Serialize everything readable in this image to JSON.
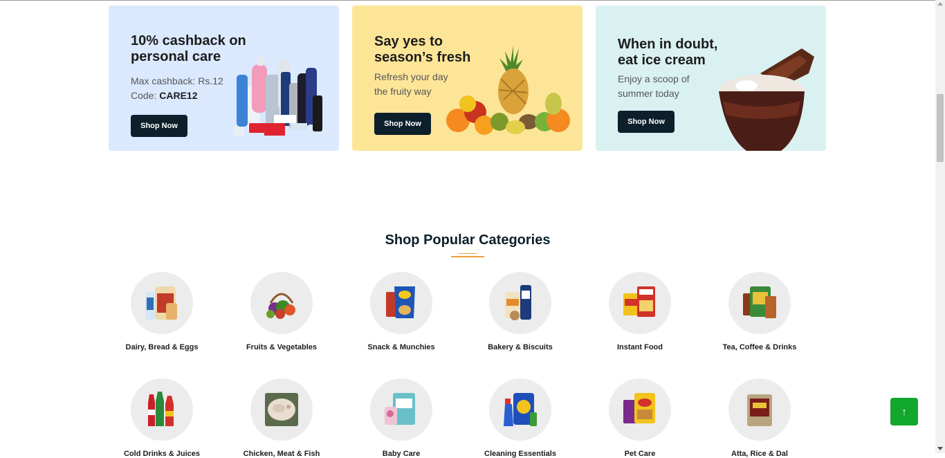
{
  "banners": [
    {
      "title": "10% cashback on\npersonal care",
      "subtitle_prefix": "Max cashback: Rs.12",
      "code_label": "Code: ",
      "code": "CARE12",
      "button": "Shop Now"
    },
    {
      "title": "Say yes to\nseason’s fresh",
      "subtitle": "Refresh your day\nthe fruity way",
      "button": "Shop Now"
    },
    {
      "title": "When in doubt,\neat ice cream",
      "subtitle": "Enjoy a scoop of\nsummer today",
      "button": "Shop Now"
    }
  ],
  "section_title": "Shop Popular Categories",
  "categories": [
    {
      "label": "Dairy, Bread & Eggs",
      "icon": "bread-icon"
    },
    {
      "label": "Fruits & Vegetables",
      "icon": "veg-basket-icon"
    },
    {
      "label": "Snack & Munchies",
      "icon": "chips-icon"
    },
    {
      "label": "Bakery & Biscuits",
      "icon": "biscuit-icon"
    },
    {
      "label": "Instant Food",
      "icon": "instant-food-icon"
    },
    {
      "label": "Tea, Coffee & Drinks",
      "icon": "tea-icon"
    },
    {
      "label": "Cold Drinks & Juices",
      "icon": "bottles-icon"
    },
    {
      "label": "Chicken, Meat & Fish",
      "icon": "fish-icon"
    },
    {
      "label": "Baby Care",
      "icon": "diaper-icon"
    },
    {
      "label": "Cleaning Essentials",
      "icon": "detergent-icon"
    },
    {
      "label": "Pet Care",
      "icon": "pet-food-icon"
    },
    {
      "label": "Atta, Rice & Dal",
      "icon": "rice-bag-icon"
    }
  ],
  "scroll_top_button": "↑",
  "colors": {
    "accent": "#0aad0a",
    "banner1": "#dbe9ff",
    "banner2": "#fde598",
    "banner3": "#daf1f2",
    "button": "#0c1f2b",
    "underline": "#f0a13a"
  }
}
